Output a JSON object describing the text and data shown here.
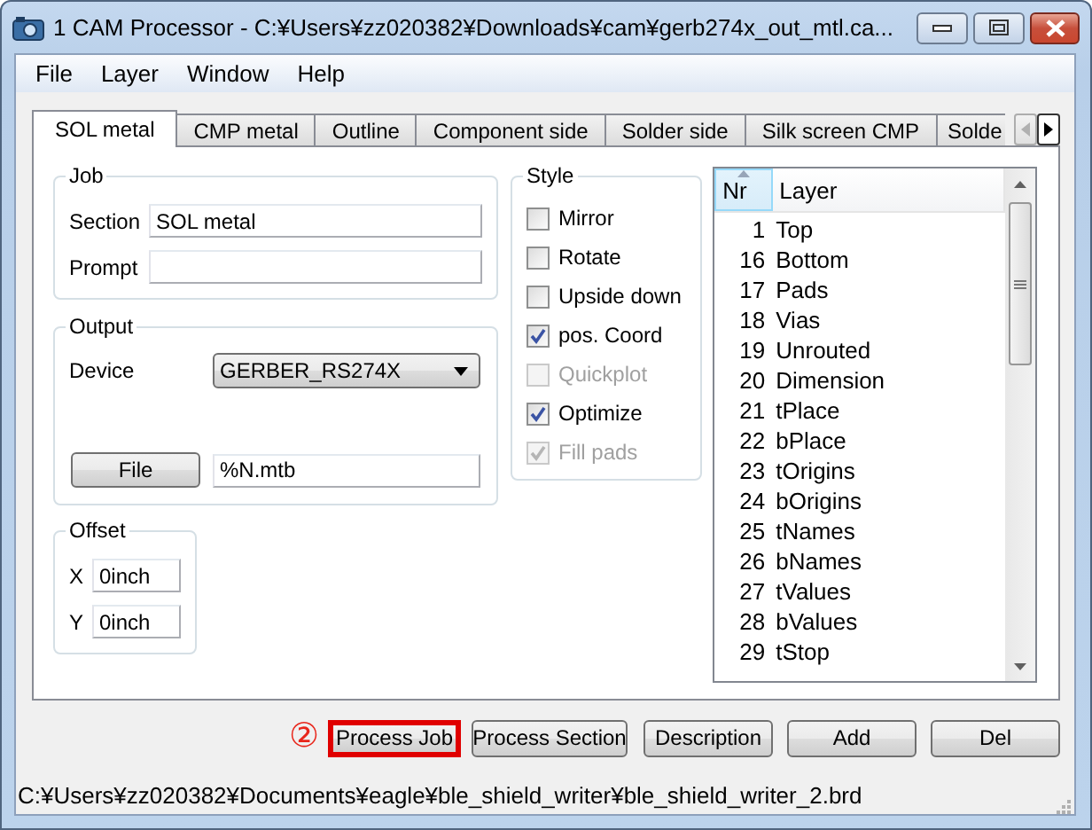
{
  "window": {
    "title": "1 CAM Processor - C:¥Users¥zz020382¥Downloads¥cam¥gerb274x_out_mtl.ca..."
  },
  "menu": [
    {
      "label": "File"
    },
    {
      "label": "Layer"
    },
    {
      "label": "Window"
    },
    {
      "label": "Help"
    }
  ],
  "tabs": [
    {
      "label": "SOL metal",
      "selected": true
    },
    {
      "label": "CMP metal",
      "selected": false
    },
    {
      "label": "Outline",
      "selected": false
    },
    {
      "label": "Component side",
      "selected": false
    },
    {
      "label": "Solder side",
      "selected": false
    },
    {
      "label": "Silk screen CMP",
      "selected": false
    },
    {
      "label": "Solde",
      "selected": false
    }
  ],
  "job": {
    "title": "Job",
    "section_label": "Section",
    "section_value": "SOL metal",
    "prompt_label": "Prompt"
  },
  "output": {
    "title": "Output",
    "device_label": "Device",
    "device_value": "GERBER_RS274X",
    "file_button": "File",
    "file_value": "%N.mtb"
  },
  "offset": {
    "title": "Offset",
    "fields": [
      {
        "label": "X",
        "value": "0inch"
      },
      {
        "label": "Y",
        "value": "0inch"
      }
    ]
  },
  "style": {
    "title": "Style",
    "options": [
      {
        "label": "Mirror",
        "checked": false,
        "disabled": false
      },
      {
        "label": "Rotate",
        "checked": false,
        "disabled": false
      },
      {
        "label": "Upside down",
        "checked": false,
        "disabled": false
      },
      {
        "label": "pos. Coord",
        "checked": true,
        "disabled": false
      },
      {
        "label": "Quickplot",
        "checked": false,
        "disabled": true
      },
      {
        "label": "Optimize",
        "checked": true,
        "disabled": false
      },
      {
        "label": "Fill pads",
        "checked": true,
        "disabled": true
      }
    ]
  },
  "layers": {
    "columns": [
      {
        "label": "Nr",
        "sorted": true
      },
      {
        "label": "Layer",
        "sorted": false
      }
    ],
    "rows": [
      {
        "nr": "1",
        "name": "Top"
      },
      {
        "nr": "16",
        "name": "Bottom"
      },
      {
        "nr": "17",
        "name": "Pads"
      },
      {
        "nr": "18",
        "name": "Vias"
      },
      {
        "nr": "19",
        "name": "Unrouted"
      },
      {
        "nr": "20",
        "name": "Dimension"
      },
      {
        "nr": "21",
        "name": "tPlace"
      },
      {
        "nr": "22",
        "name": "bPlace"
      },
      {
        "nr": "23",
        "name": "tOrigins"
      },
      {
        "nr": "24",
        "name": "bOrigins"
      },
      {
        "nr": "25",
        "name": "tNames"
      },
      {
        "nr": "26",
        "name": "bNames"
      },
      {
        "nr": "27",
        "name": "tValues"
      },
      {
        "nr": "28",
        "name": "bValues"
      },
      {
        "nr": "29",
        "name": "tStop"
      }
    ]
  },
  "annotation": "②",
  "buttons": [
    {
      "label": "Process Job",
      "highlighted": true
    },
    {
      "label": "Process Section",
      "highlighted": false
    },
    {
      "label": "Description",
      "highlighted": false
    },
    {
      "label": "Add",
      "highlighted": false
    },
    {
      "label": "Del",
      "highlighted": false
    }
  ],
  "status_bar": "C:¥Users¥zz020382¥Documents¥eagle¥ble_shield_writer¥ble_shield_writer_2.brd"
}
